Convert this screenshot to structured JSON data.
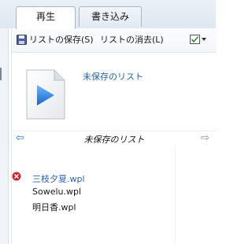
{
  "tabs": [
    {
      "label": "再生"
    },
    {
      "label": "書き込み"
    }
  ],
  "toolbar": {
    "save_label": "リストの保存(S)",
    "clear_label": "リストの消去(L)",
    "save_icon": "floppy-disk-icon",
    "options_icon": "list-options-icon"
  },
  "playlist": {
    "header_title": "未保存のリスト",
    "title": "未保存のリスト",
    "items": [
      {
        "name": "三枝夕夏.wpl",
        "status": "error"
      },
      {
        "name": "Sowelu.wpl",
        "status": "ok"
      },
      {
        "name": "明日香.wpl",
        "status": "ok"
      }
    ]
  },
  "colors": {
    "accent": "#1f63b5",
    "error": "#c8262a"
  }
}
